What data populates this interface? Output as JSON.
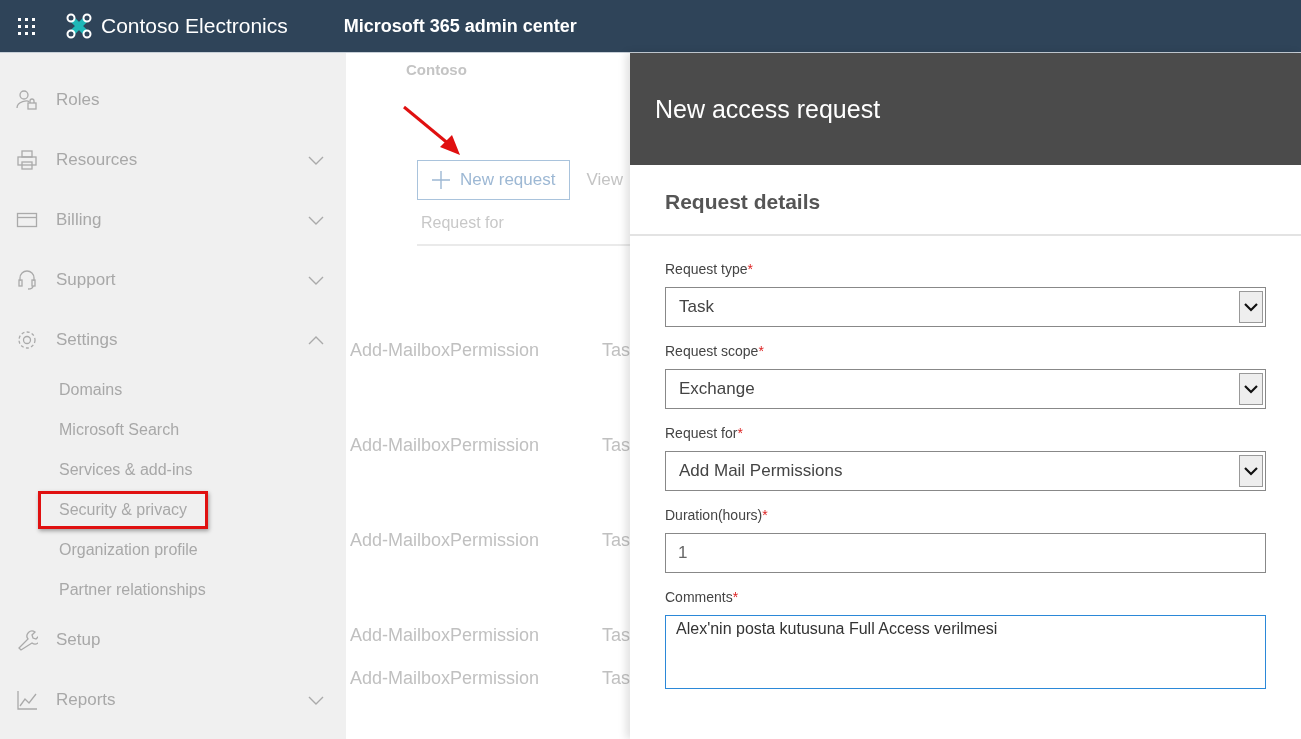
{
  "header": {
    "brand": "Contoso Electronics",
    "title": "Microsoft 365 admin center"
  },
  "sidebar": {
    "items": [
      {
        "label": "Roles",
        "kind": "link"
      },
      {
        "label": "Resources",
        "kind": "group",
        "expanded": false
      },
      {
        "label": "Billing",
        "kind": "group",
        "expanded": false
      },
      {
        "label": "Support",
        "kind": "group",
        "expanded": false
      },
      {
        "label": "Settings",
        "kind": "group",
        "expanded": true,
        "children": [
          {
            "label": "Domains",
            "highlighted": false
          },
          {
            "label": "Microsoft Search",
            "highlighted": false
          },
          {
            "label": "Services & add-ins",
            "highlighted": false
          },
          {
            "label": "Security & privacy",
            "highlighted": true
          },
          {
            "label": "Organization profile",
            "highlighted": false
          },
          {
            "label": "Partner relationships",
            "highlighted": false
          }
        ]
      },
      {
        "label": "Setup",
        "kind": "link"
      },
      {
        "label": "Reports",
        "kind": "group",
        "expanded": false
      }
    ]
  },
  "content": {
    "breadcrumb": "Contoso",
    "new_request_button": "New request",
    "view_link": "View",
    "table": {
      "columns": [
        "Request for"
      ],
      "rows": [
        {
          "column_1": "Add-MailboxPermission",
          "column_2": "Tas"
        },
        {
          "column_1": "Add-MailboxPermission",
          "column_2": "Tas"
        },
        {
          "column_1": "Add-MailboxPermission",
          "column_2": "Tas"
        },
        {
          "column_1": "Add-MailboxPermission",
          "column_2": "Tas"
        },
        {
          "column_1": "Add-MailboxPermission",
          "column_2": "Tas"
        }
      ]
    }
  },
  "panel": {
    "title": "New access request",
    "section": "Request details",
    "fields": [
      {
        "label": "Request type",
        "required_mark": "*",
        "kind": "select",
        "value": "Task",
        "focused": false
      },
      {
        "label": "Request scope",
        "required_mark": "*",
        "kind": "select",
        "value": "Exchange",
        "focused": false
      },
      {
        "label": "Request for",
        "required_mark": "*",
        "kind": "select",
        "value": "Add Mail Permissions",
        "focused": false
      },
      {
        "label": "Duration(hours)",
        "required_mark": "*",
        "kind": "input",
        "value": "1",
        "focused": false
      },
      {
        "label": "Comments",
        "required_mark": "*",
        "kind": "textarea",
        "value": "Alex'nin posta kutusuna Full Access verilmesi",
        "focused": true
      }
    ]
  }
}
